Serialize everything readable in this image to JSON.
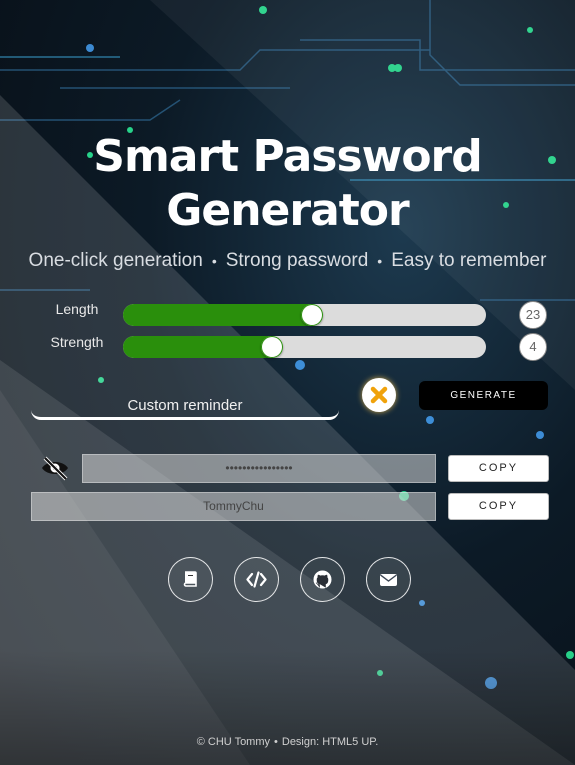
{
  "hero": {
    "title_line1": "Smart Password",
    "title_line2": "Generator",
    "features": [
      "One-click generation",
      "Strong password",
      "Easy to remember"
    ],
    "separator": "•"
  },
  "controls": {
    "length": {
      "label": "Length",
      "value": 23,
      "display": "23",
      "fill_fraction": 0.52
    },
    "strength": {
      "label": "Strength",
      "value": 4,
      "display": "4",
      "fill_fraction": 0.41
    },
    "accent_color": "#2a8f0c"
  },
  "reminder": {
    "placeholder": "Custom reminder",
    "value": ""
  },
  "actions": {
    "clear_icon": "close-icon",
    "generate_label": "GENERATE"
  },
  "output": {
    "visibility_icon": "eye-off-icon",
    "password_masked": "••••••••••••••••",
    "reminder_value": "TommyChu",
    "copy_label": "COPY"
  },
  "links": [
    {
      "name": "book-icon"
    },
    {
      "name": "code-icon"
    },
    {
      "name": "github-icon"
    },
    {
      "name": "mail-icon"
    }
  ],
  "footer": {
    "author": "© CHU Tommy",
    "separator": "•",
    "design": "Design: HTML5 UP."
  }
}
